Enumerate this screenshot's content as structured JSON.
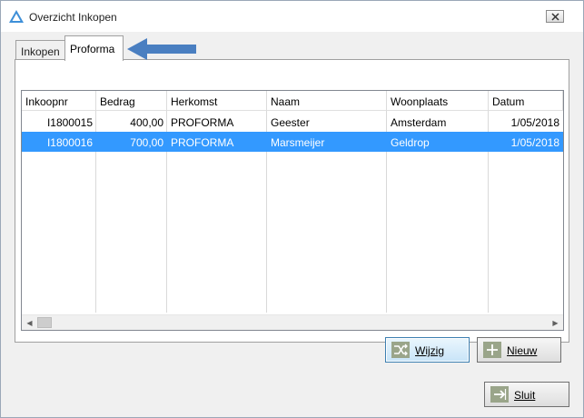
{
  "window": {
    "title": "Overzicht Inkopen"
  },
  "icons": {
    "app": "app-triangle-icon",
    "close": "close-icon",
    "edit": "shuffle-icon",
    "new": "plus-icon",
    "close_btn": "exit-arrow-icon"
  },
  "tabs": [
    {
      "label": "Inkopen",
      "active": false
    },
    {
      "label": "Proforma",
      "active": true
    }
  ],
  "table": {
    "columns": [
      "Inkoopnr",
      "Bedrag",
      "Herkomst",
      "Naam",
      "Woonplaats",
      "Datum"
    ],
    "rows": [
      {
        "inkoopnr": "I1800015",
        "bedrag": "400,00",
        "herkomst": "PROFORMA",
        "naam": "Geester",
        "woonplaats": "Amsterdam",
        "datum": "1/05/2018",
        "selected": false
      },
      {
        "inkoopnr": "I1800016",
        "bedrag": "700,00",
        "herkomst": "PROFORMA",
        "naam": "Marsmeijer",
        "woonplaats": "Geldrop",
        "datum": "1/05/2018",
        "selected": true
      }
    ]
  },
  "buttons": {
    "wijzig": {
      "mnemonic": "W",
      "rest": "ijzig"
    },
    "nieuw": {
      "mnemonic": "N",
      "rest": "ieuw"
    },
    "sluit": {
      "mnemonic": "S",
      "rest": "luit"
    }
  },
  "colors": {
    "selection": "#3399ff",
    "annotation_arrow": "#4a7fc1",
    "accent_icon": "#3d8fd8"
  }
}
